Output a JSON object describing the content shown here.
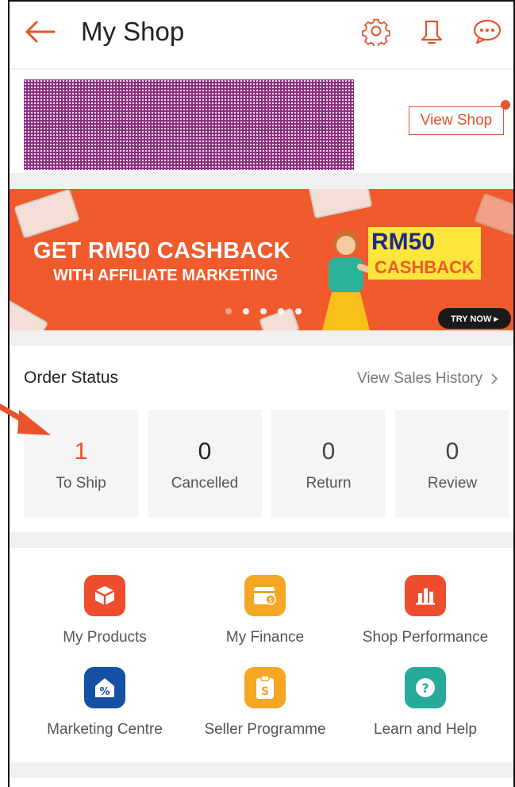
{
  "header": {
    "title": "My Shop",
    "back_icon": "arrow-left-icon",
    "icons": [
      "gear-icon",
      "bell-icon",
      "chat-icon"
    ]
  },
  "profile": {
    "view_shop_label": "View Shop"
  },
  "banner": {
    "line1": "GET RM50 CASHBACK",
    "line2": "WITH AFFILIATE MARKETING",
    "cashback_amount": "RM50",
    "cashback_label": "CASHBACK",
    "try_now_label": "TRY NOW ▸",
    "slide_count": 5,
    "active_slide": 2
  },
  "order_status": {
    "title": "Order Status",
    "sales_history_label": "View Sales History",
    "items": [
      {
        "count": "1",
        "label": "To Ship"
      },
      {
        "count": "0",
        "label": "Cancelled"
      },
      {
        "count": "0",
        "label": "Return"
      },
      {
        "count": "0",
        "label": "Review"
      }
    ]
  },
  "tools": [
    {
      "label": "My Products",
      "icon": "box-icon",
      "color": "#ee4d2d"
    },
    {
      "label": "My Finance",
      "icon": "wallet-icon",
      "color": "#f5a623"
    },
    {
      "label": "Shop Performance",
      "icon": "bar-chart-icon",
      "color": "#ee4d2d"
    },
    {
      "label": "Marketing Centre",
      "icon": "discount-tag-icon",
      "color": "#1450a3"
    },
    {
      "label": "Seller Programme",
      "icon": "clipboard-icon",
      "color": "#f5a623"
    },
    {
      "label": "Learn and Help",
      "icon": "question-icon",
      "color": "#26aa99"
    }
  ],
  "colors": {
    "brand": "#ee4d2d",
    "banner_bg": "#f05a2c",
    "highlight_count": "#e8532b"
  }
}
